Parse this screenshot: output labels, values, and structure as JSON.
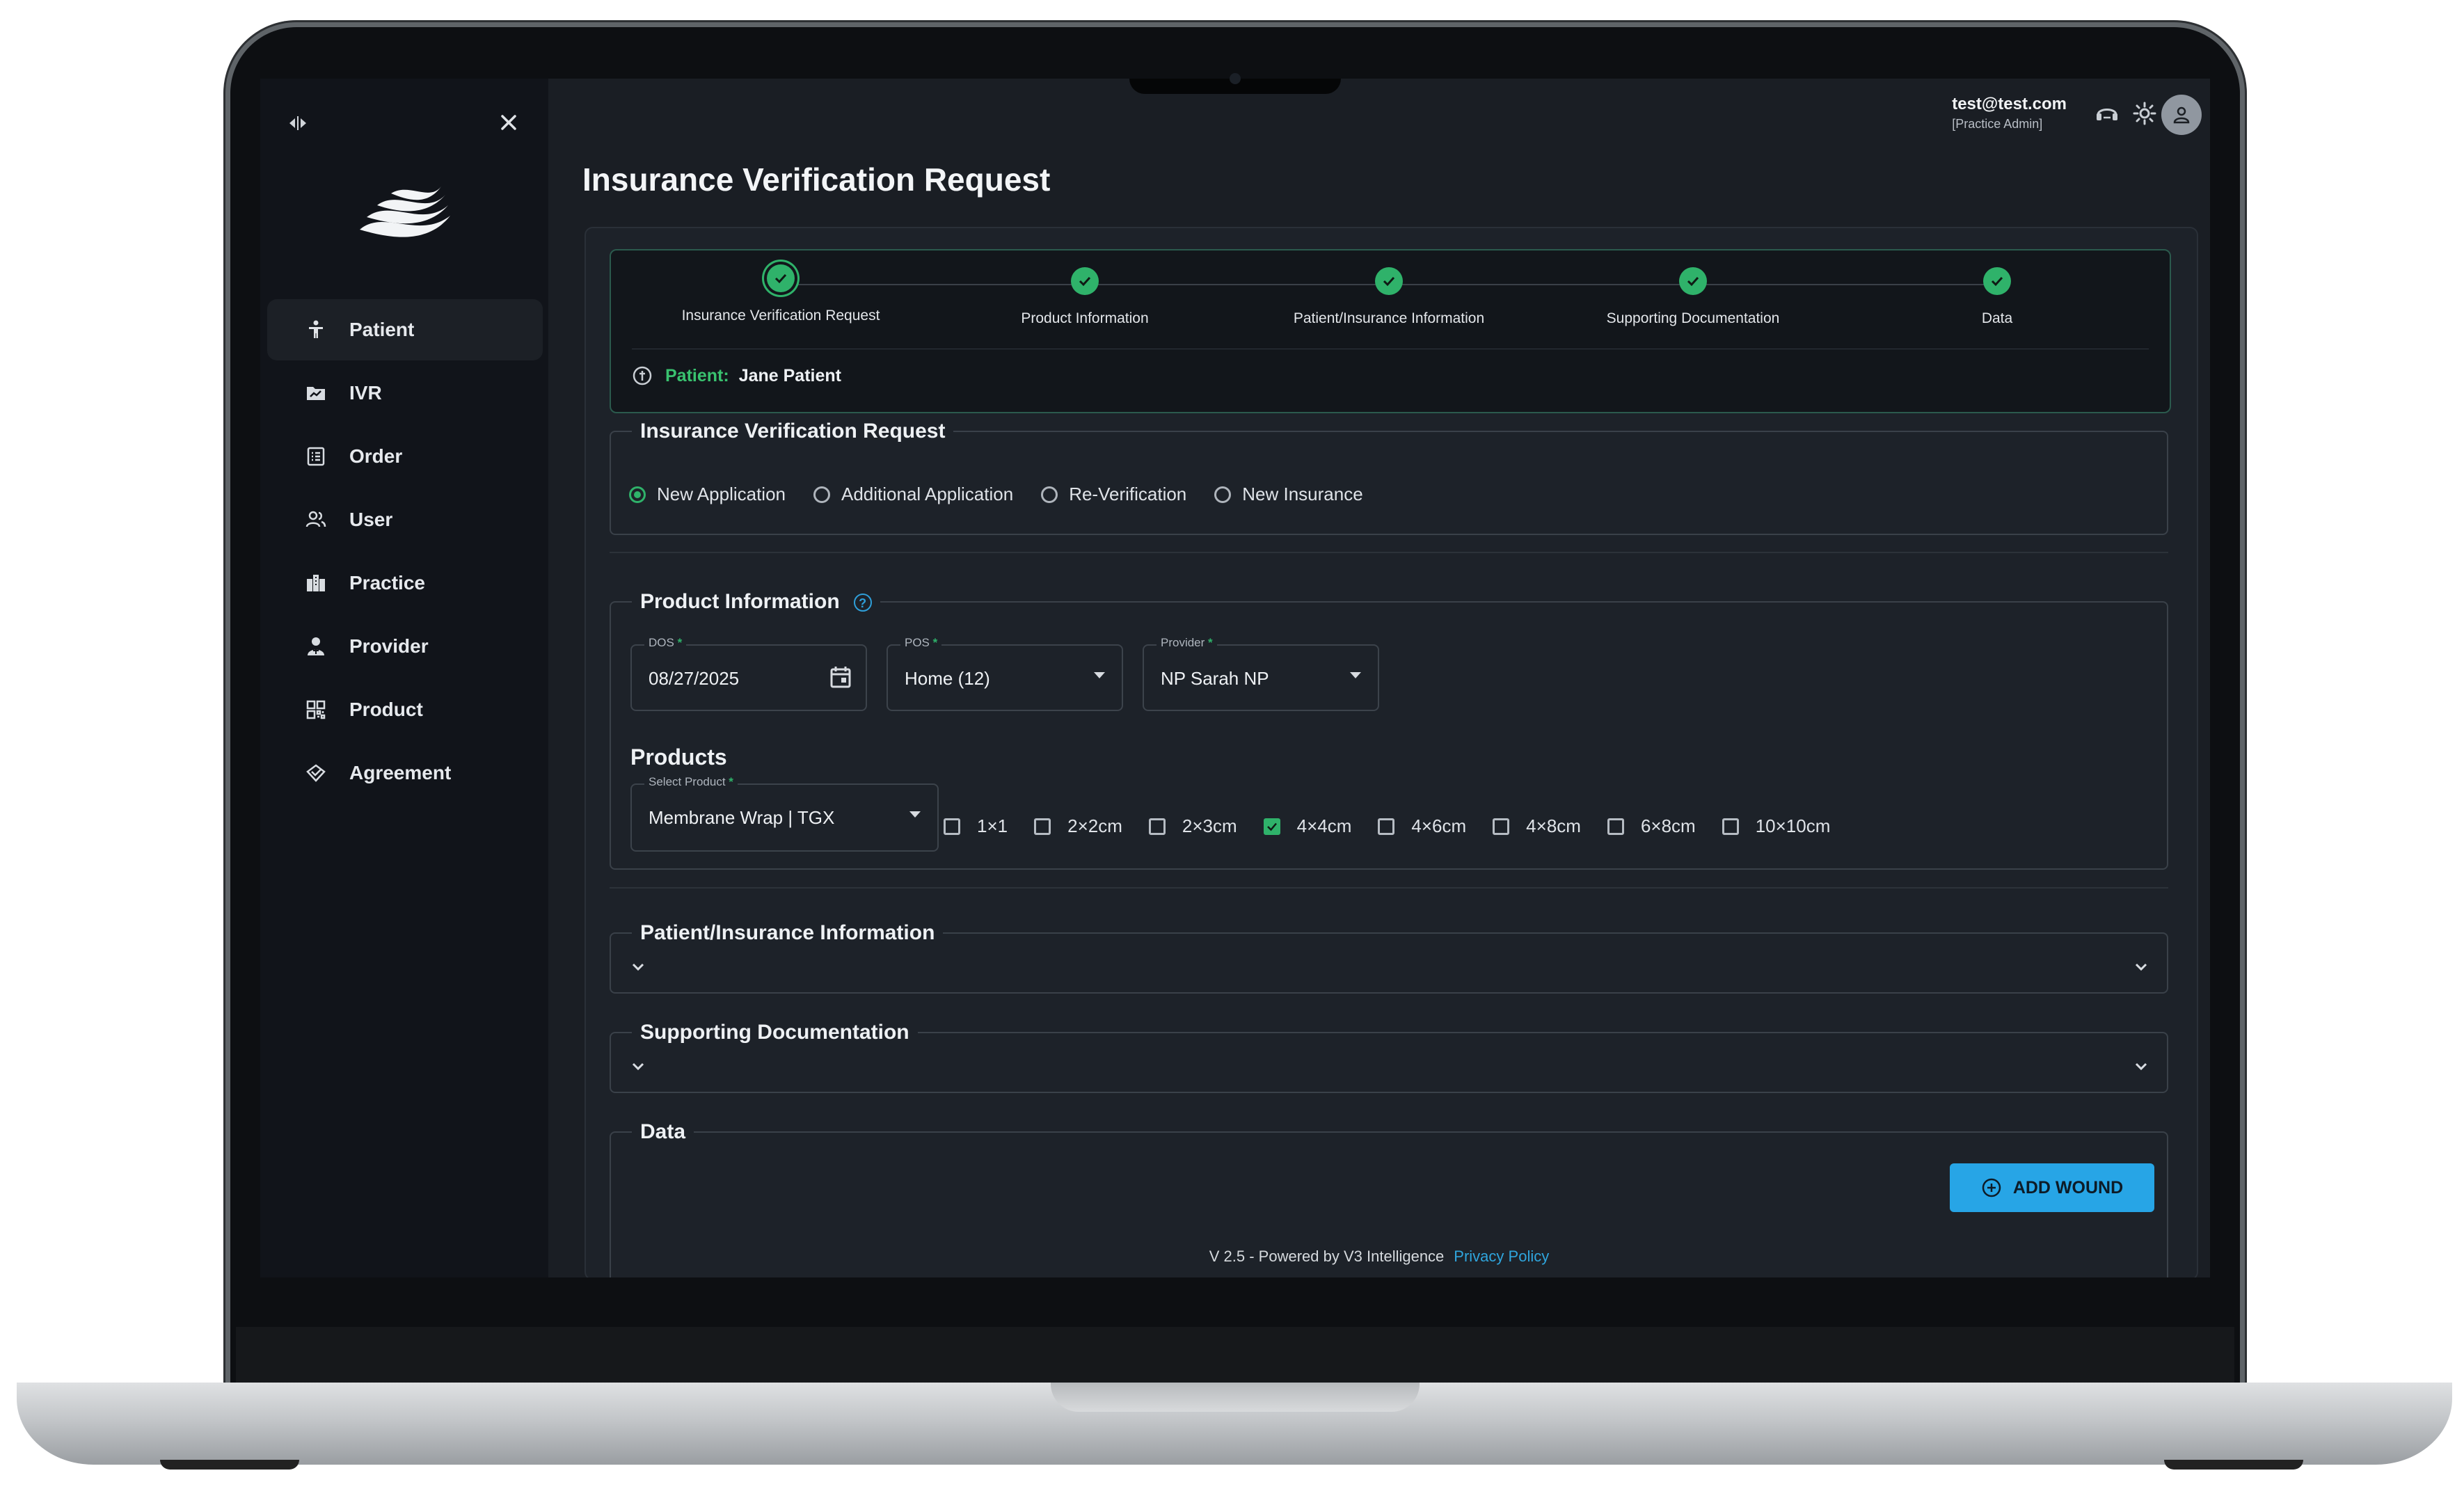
{
  "sidebar": {
    "items": [
      {
        "label": "Patient",
        "icon": "person-icon"
      },
      {
        "label": "IVR",
        "icon": "folder-chart-icon"
      },
      {
        "label": "Order",
        "icon": "list-icon"
      },
      {
        "label": "User",
        "icon": "users-icon"
      },
      {
        "label": "Practice",
        "icon": "building-icon"
      },
      {
        "label": "Provider",
        "icon": "provider-icon"
      },
      {
        "label": "Product",
        "icon": "grid-icon"
      },
      {
        "label": "Agreement",
        "icon": "handshake-icon"
      }
    ],
    "active": "Patient"
  },
  "topbar": {
    "email": "test@test.com",
    "role": "[Practice Admin]"
  },
  "page": {
    "title": "Insurance Verification Request"
  },
  "stepper": {
    "steps": [
      "Insurance Verification Request",
      "Product Information",
      "Patient/Insurance Information",
      "Supporting Documentation",
      "Data"
    ],
    "patient_label": "Patient:",
    "patient_name": "Jane Patient"
  },
  "ivr_section": {
    "title": "Insurance Verification Request",
    "options": [
      "New Application",
      "Additional Application",
      "Re-Verification",
      "New Insurance"
    ],
    "selected": "New Application"
  },
  "product_section": {
    "title": "Product Information",
    "dos_label": "DOS",
    "dos_value": "08/27/2025",
    "pos_label": "POS",
    "pos_value": "Home (12)",
    "provider_label": "Provider",
    "provider_value": "NP Sarah NP",
    "products_heading": "Products",
    "select_product_label": "Select Product",
    "select_product_value": "Membrane Wrap | TGX",
    "sizes": [
      "1×1",
      "2×2cm",
      "2×3cm",
      "4×4cm",
      "4×6cm",
      "4×8cm",
      "6×8cm",
      "10×10cm"
    ],
    "checked_size": "4×4cm",
    "required_mark": "*"
  },
  "patient_insurance_section": {
    "title": "Patient/Insurance Information"
  },
  "supporting_section": {
    "title": "Supporting Documentation"
  },
  "data_section": {
    "title": "Data",
    "add_button": "ADD WOUND"
  },
  "footer": {
    "text": "V 2.5 - Powered by V3 Intelligence",
    "link": "Privacy Policy"
  },
  "colors": {
    "accent_green": "#2fb26a",
    "accent_blue": "#27a5e6",
    "background": "#1a1e24"
  }
}
